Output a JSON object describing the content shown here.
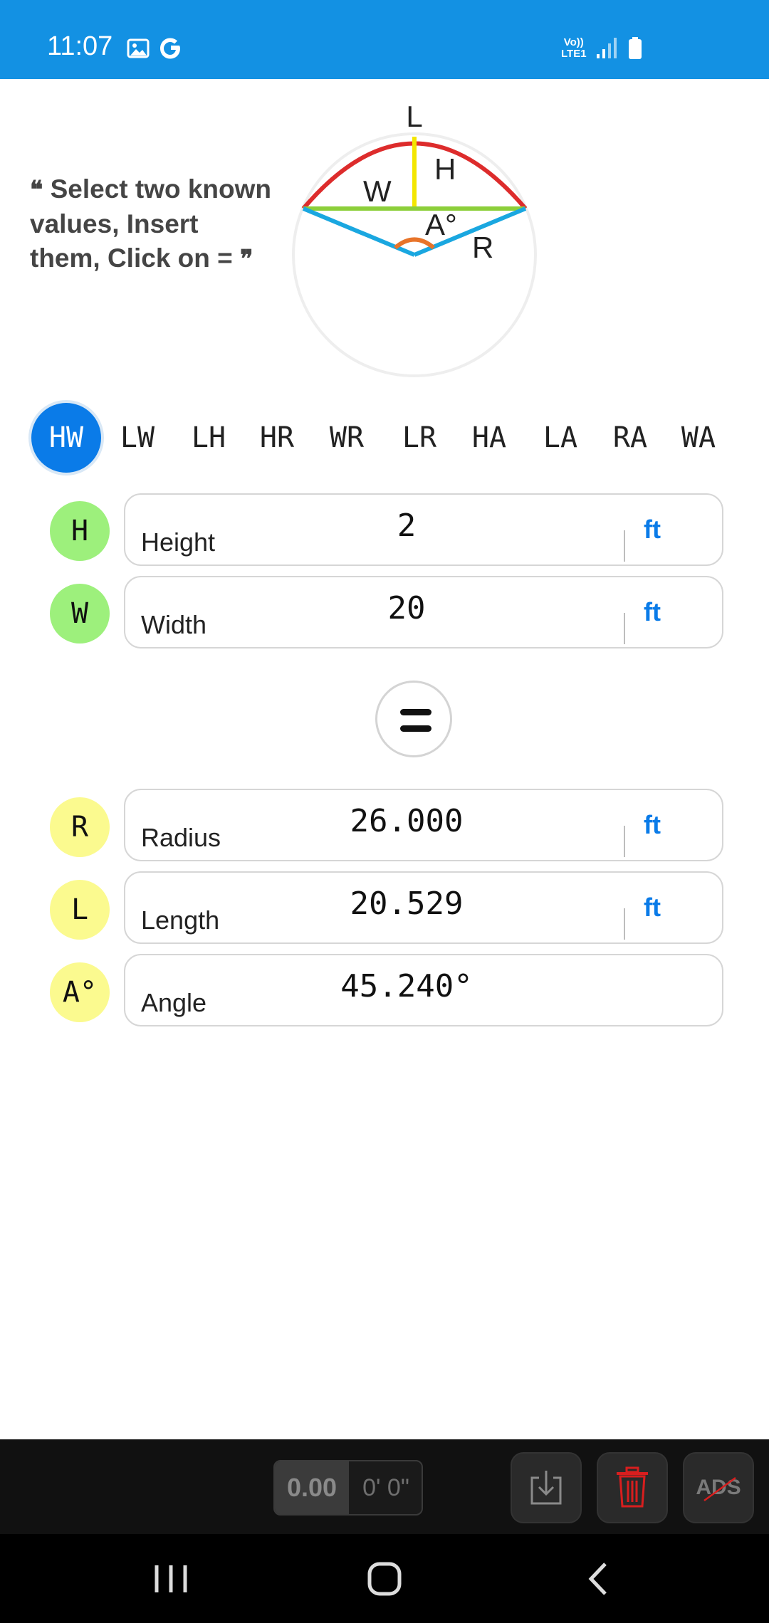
{
  "status_bar": {
    "time": "11:07",
    "network_line1": "Vo))",
    "network_line2": "LTE1",
    "icons": [
      "photo-icon",
      "google-g-icon",
      "signal-icon",
      "battery-icon"
    ]
  },
  "hint": {
    "open_quote": "❝",
    "text": "Select two known values, Insert them, Click on",
    "equals_symbol": "=",
    "close_quote": "❞"
  },
  "diagram": {
    "labels": {
      "length": "L",
      "height": "H",
      "width": "W",
      "angle": "A°",
      "radius": "R"
    },
    "colors": {
      "arc": "#dd2c2c",
      "height": "#f3e600",
      "chord": "#8ccf3a",
      "radius": "#1aa7e0",
      "angle": "#e8742a",
      "circle": "#eeeeee"
    }
  },
  "mode_tabs": {
    "items": [
      "HW",
      "LW",
      "LH",
      "HR",
      "WR",
      "LR",
      "HA",
      "LA",
      "RA",
      "WA"
    ],
    "active": "HW"
  },
  "inputs": [
    {
      "badge": "H",
      "label": "Height",
      "value": "2",
      "unit": "ft"
    },
    {
      "badge": "W",
      "label": "Width",
      "value": "20",
      "unit": "ft"
    }
  ],
  "results": [
    {
      "badge": "R",
      "label": "Radius",
      "value": "26.000",
      "unit": "ft"
    },
    {
      "badge": "L",
      "label": "Length",
      "value": "20.529",
      "unit": "ft"
    },
    {
      "badge": "A°",
      "label": "Angle",
      "value": "45.240°",
      "unit": ""
    }
  ],
  "toolbar": {
    "decimal_value": "0.00",
    "feet_inches_value": "0' 0\"",
    "ads_label": "ADS"
  },
  "colors": {
    "status_bar": "#1391e3",
    "accent_blue": "#0a7be8",
    "input_badge": "#9df07c",
    "result_badge": "#fbfa8f",
    "delete_red": "#d81e1e"
  }
}
